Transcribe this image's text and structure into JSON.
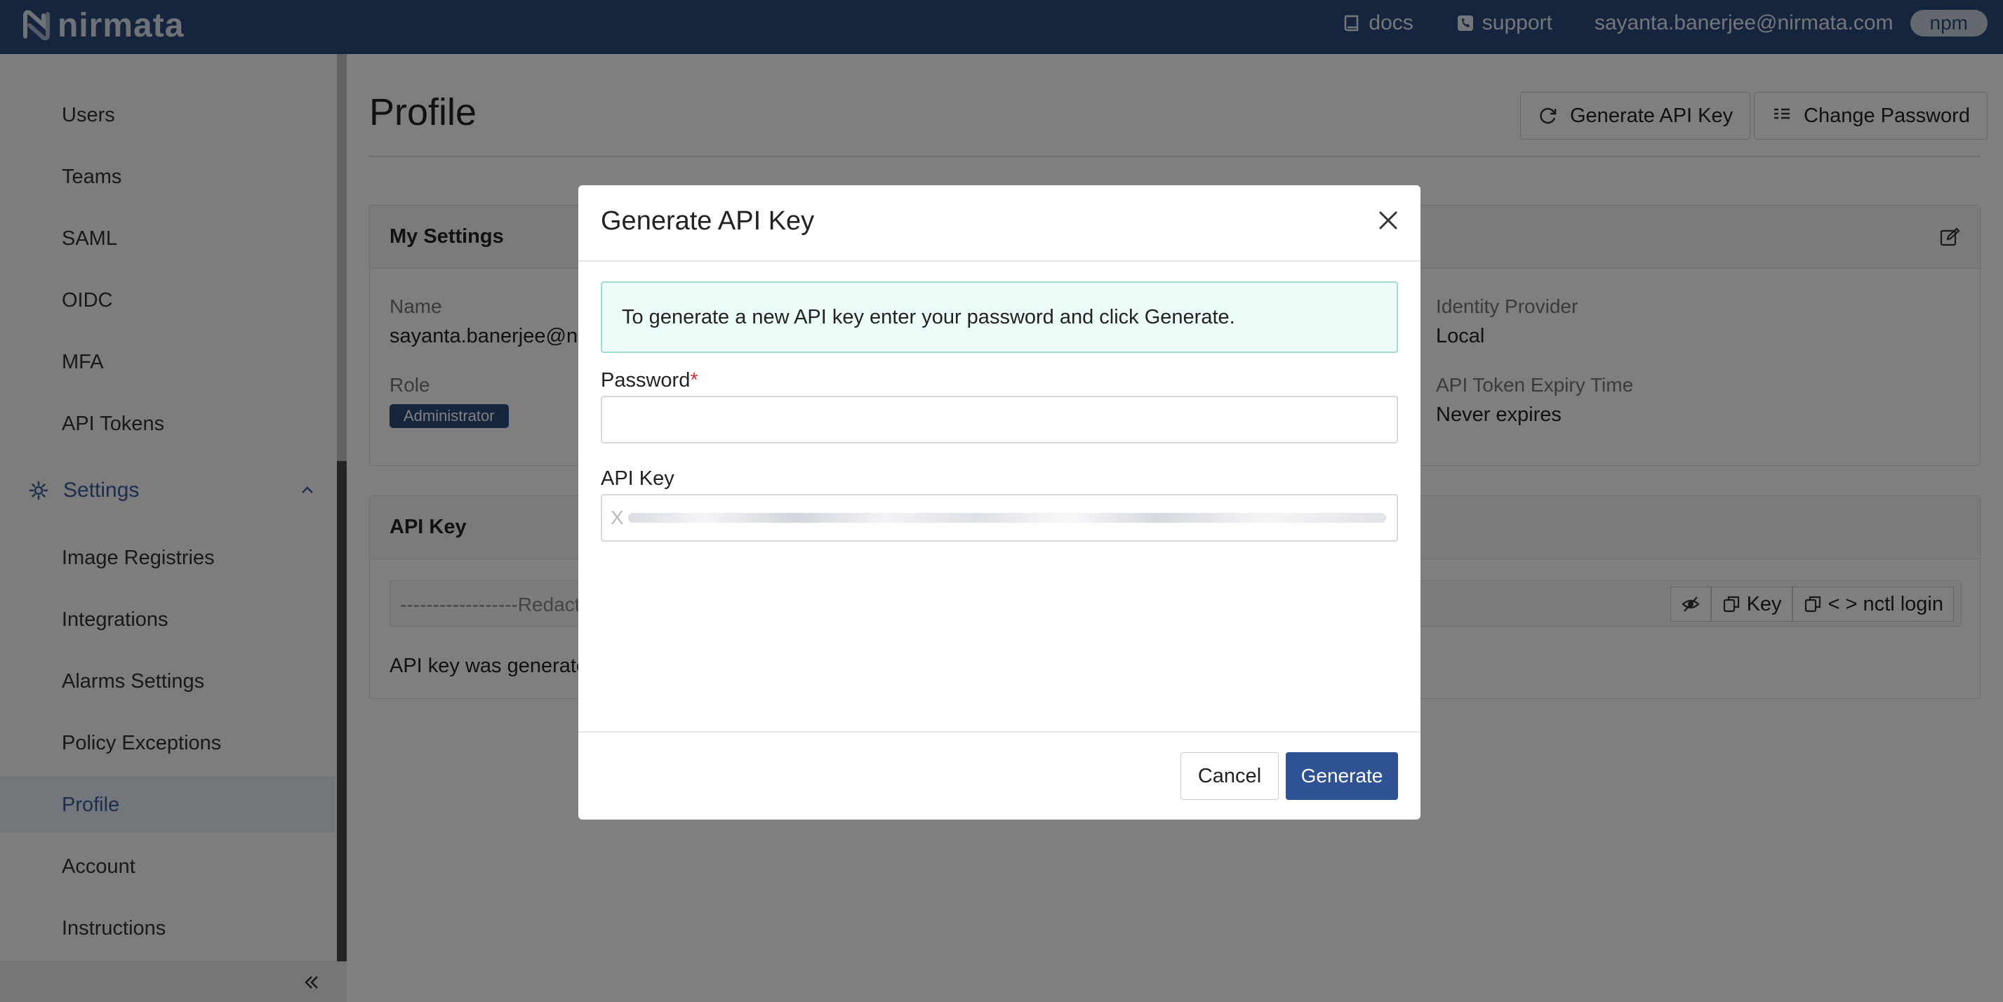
{
  "topbar": {
    "logo_text": "nirmata",
    "docs_label": "docs",
    "support_label": "support",
    "user_email": "sayanta.banerjee@nirmata.com",
    "tenant_badge": "npm"
  },
  "sidebar": {
    "items": [
      {
        "label": "Users"
      },
      {
        "label": "Teams"
      },
      {
        "label": "SAML"
      },
      {
        "label": "OIDC"
      },
      {
        "label": "MFA"
      },
      {
        "label": "API Tokens"
      }
    ],
    "settings_section": {
      "label": "Settings",
      "items": [
        {
          "label": "Image Registries"
        },
        {
          "label": "Integrations"
        },
        {
          "label": "Alarms Settings"
        },
        {
          "label": "Policy Exceptions"
        },
        {
          "label": "Profile",
          "active": true
        },
        {
          "label": "Account"
        },
        {
          "label": "Instructions"
        }
      ]
    }
  },
  "page": {
    "title": "Profile",
    "generate_api_key_label": "Generate API Key",
    "change_password_label": "Change Password"
  },
  "my_settings": {
    "title": "My Settings",
    "name_label": "Name",
    "name_value": "sayanta.banerjee@nirmata.com",
    "role_label": "Role",
    "role_value": "Administrator",
    "identity_provider_label": "Identity Provider",
    "identity_provider_value": "Local",
    "token_expiry_label": "API Token Expiry Time",
    "token_expiry_value": "Never expires"
  },
  "api_key_card": {
    "title": "API Key",
    "key_masked": "------------------Redacted------------------",
    "copy_key_label": "Key",
    "copy_login_label": "< > nctl login",
    "note": "API key was generated"
  },
  "modal": {
    "title": "Generate API Key",
    "info": "To generate a new API key enter your password and click Generate.",
    "password_label": "Password",
    "required_mark": "*",
    "password_value": "",
    "api_key_label": "API Key",
    "api_key_value": "X",
    "cancel_label": "Cancel",
    "generate_label": "Generate"
  },
  "colors": {
    "topbar": "#2c4a7c",
    "primary_button": "#2f5294",
    "info_bg": "#ebfcf9",
    "info_border": "#9fdcd2",
    "sidebar_active": "#e7eef8"
  }
}
